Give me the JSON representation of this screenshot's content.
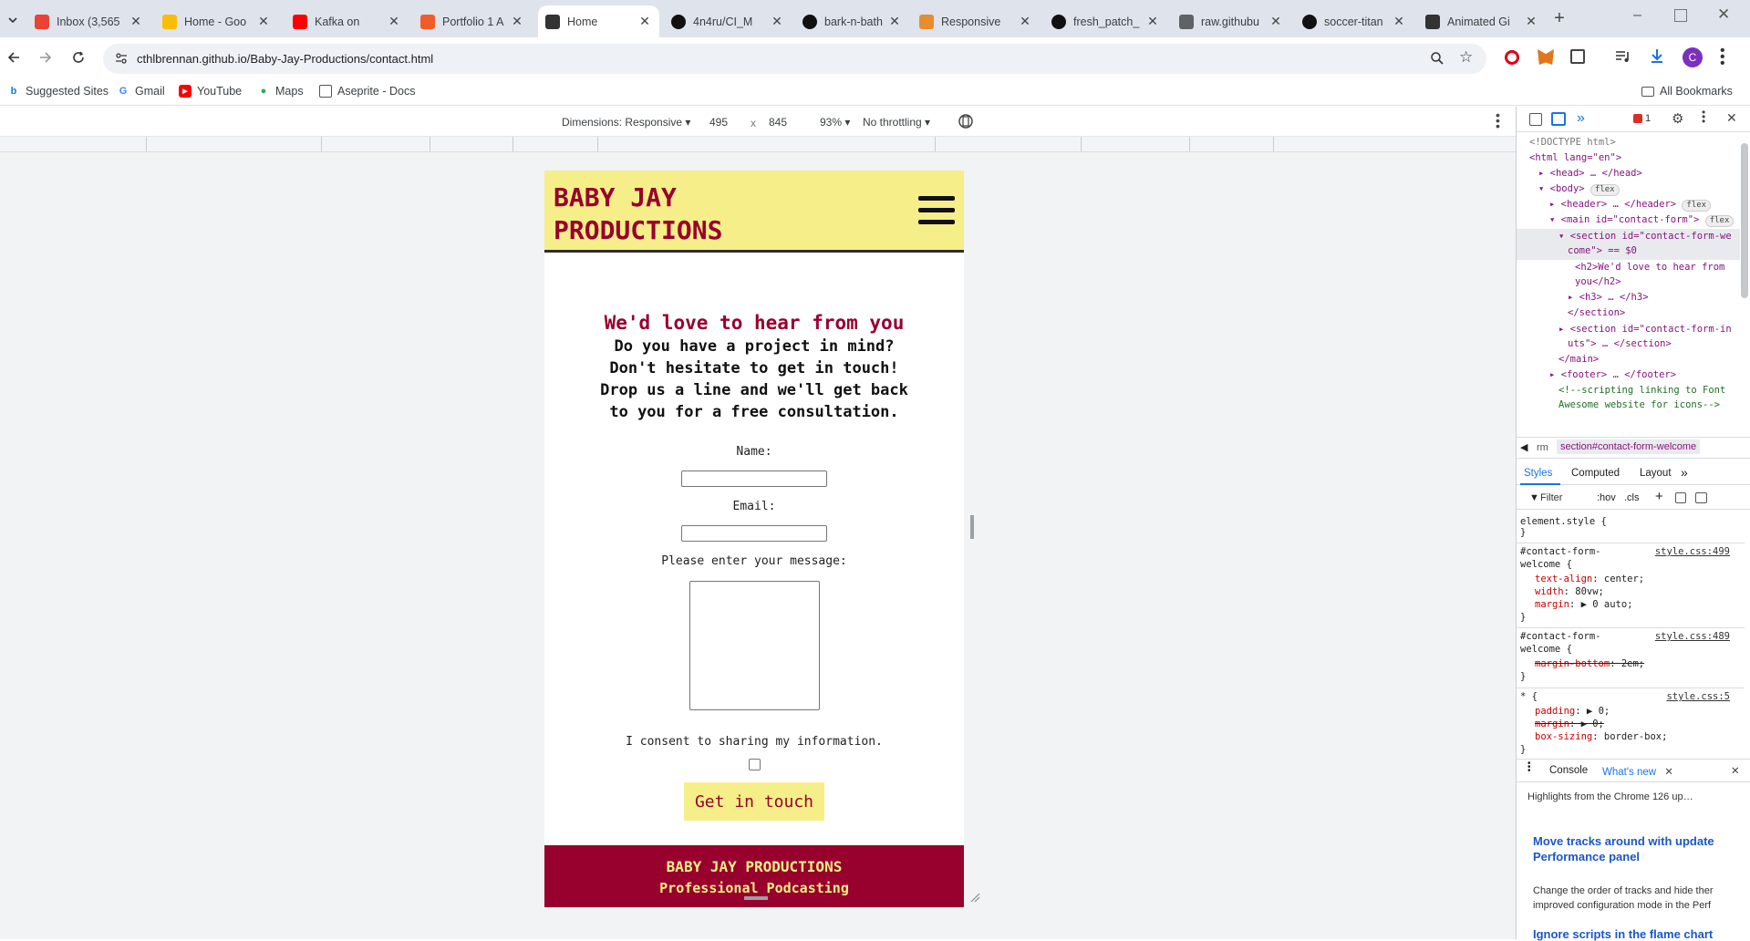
{
  "browser": {
    "tabs": [
      {
        "title": "Inbox (3,565",
        "favicon": "gmail-icon",
        "color": "#ea4335",
        "active": false
      },
      {
        "title": "Home - Goo",
        "favicon": "drive-icon",
        "color": "#fbbc04",
        "active": false
      },
      {
        "title": "Kafka on",
        "favicon": "youtube-icon",
        "color": "#ff0000",
        "active": false
      },
      {
        "title": "Portfolio 1 A",
        "favicon": "portfolio-icon",
        "color": "#f25c2a",
        "active": false
      },
      {
        "title": "Home",
        "favicon": "site-icon",
        "color": "#333333",
        "active": true
      },
      {
        "title": "4n4ru/CI_M",
        "favicon": "github-icon",
        "color": "#111111",
        "active": false
      },
      {
        "title": "bark-n-bath",
        "favicon": "github-icon",
        "color": "#111111",
        "active": false
      },
      {
        "title": "Responsive",
        "favicon": "rainbow-icon",
        "color": "#e58d2f",
        "active": false
      },
      {
        "title": "fresh_patch_",
        "favicon": "github-icon",
        "color": "#111111",
        "active": false
      },
      {
        "title": "raw.githubu",
        "favicon": "globe-icon",
        "color": "#5f6368",
        "active": false
      },
      {
        "title": "soccer-titan",
        "favicon": "github-icon",
        "color": "#111111",
        "active": false
      },
      {
        "title": "Animated Gi",
        "favicon": "animated-icon",
        "color": "#333333",
        "active": false
      }
    ],
    "url": "cthlbrennan.github.io/Baby-Jay-Productions/contact.html",
    "profile_initial": "C",
    "bookmarks": [
      {
        "label": "Suggested Sites"
      },
      {
        "label": "Gmail"
      },
      {
        "label": "YouTube"
      },
      {
        "label": "Maps"
      },
      {
        "label": "Aseprite - Docs"
      }
    ],
    "all_bookmarks": "All Bookmarks"
  },
  "device_toolbar": {
    "dimensions": "Dimensions: Responsive",
    "width": "495",
    "times": "x",
    "height": "845",
    "zoom": "93%",
    "throttling": "No throttling"
  },
  "site": {
    "brand_line1": "BABY JAY",
    "brand_line2": "PRODUCTIONS",
    "welcome_heading": "We'd love to hear from you",
    "welcome_sub": "Do you have a project in mind? Don't hesitate to get in touch! Drop us a line and we'll get back to you for a free consultation.",
    "name_label": "Name:",
    "email_label": "Email:",
    "message_label": "Please enter your message:",
    "consent_label": "I consent to sharing my information.",
    "submit_label": "Get in touch",
    "footer_brand": "BABY JAY PRODUCTIONS",
    "footer_tag": "Professional Podcasting"
  },
  "devtools": {
    "error_count": "1",
    "dom_lines": [
      "<!DOCTYPE html>",
      "<html lang=\"en\">",
      "<head> … </head>",
      "<body>",
      "<header> … </header>",
      "<main id=\"contact-form\">",
      "<section id=\"contact-form-we",
      "come\"> == $0",
      "<h2>We'd love to hear from",
      "you</h2>",
      "<h3> … </h3>",
      "</section>",
      "<section id=\"contact-form-in",
      "uts\"> … </section>",
      "</main>",
      "<footer> … </footer>",
      "<!--scripting linking to Font",
      "Awesome website for icons-->"
    ],
    "flex_badge": "flex",
    "breadcrumb_left": "rm",
    "breadcrumb": "section#contact-form-welcome",
    "style_tabs": [
      "Styles",
      "Computed",
      "Layout"
    ],
    "filter_label": "Filter",
    "hov": ":hov",
    "cls": ".cls",
    "rules": [
      {
        "selector": "element.style {",
        "source": "",
        "decls": [],
        "close": "}"
      },
      {
        "selector": "#contact-form-welcome {",
        "source": "style.css:499",
        "decls": [
          {
            "prop": "text-align",
            "val": "center;"
          },
          {
            "prop": "width",
            "val": "80vw;"
          },
          {
            "prop": "margin",
            "val": "▶ 0 auto;"
          }
        ],
        "close": "}"
      },
      {
        "selector": "#contact-form-welcome {",
        "source": "style.css:489",
        "decls": [
          {
            "prop": "margin-bottom",
            "val": "2em;",
            "struck": true
          }
        ],
        "close": "}"
      },
      {
        "selector": "* {",
        "source": "style.css:5",
        "decls": [
          {
            "prop": "padding",
            "val": "▶ 0;"
          },
          {
            "prop": "margin",
            "val": "▶ 0;",
            "struck": true
          },
          {
            "prop": "box-sizing",
            "val": "border-box;"
          }
        ],
        "close": "}"
      }
    ],
    "drawer_tabs": [
      "Console",
      "What's new"
    ],
    "whats_new_intro": "Highlights from the Chrome 126 up…",
    "whats_new_title1": "Move tracks around with update Performance panel",
    "whats_new_body1": "Change the order of tracks and hide ther improved configuration mode in the Perf",
    "whats_new_title2": "Ignore scripts in the flame chart"
  }
}
